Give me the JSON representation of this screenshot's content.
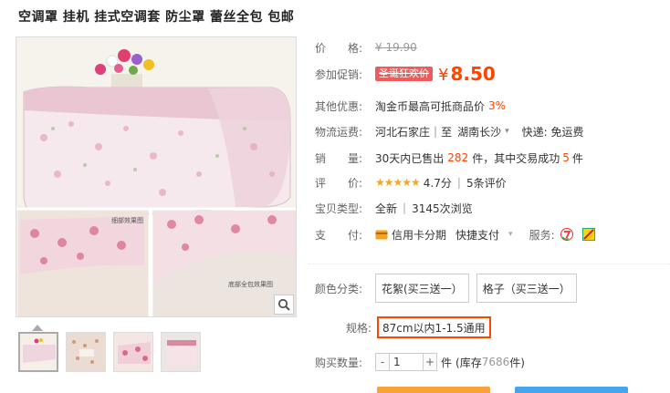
{
  "product": {
    "title": "空调罩 挂机 挂式空调套 防尘罩 蕾丝全包 包邮"
  },
  "gallery": {
    "watermark_1": "细部效果图",
    "watermark_2": "底部全包效果图",
    "thumbnails": [
      {
        "name": "thumb-1"
      },
      {
        "name": "thumb-2"
      },
      {
        "name": "thumb-3"
      },
      {
        "name": "thumb-4"
      }
    ]
  },
  "details": {
    "price_label": "价　　格:",
    "price_original": "¥ 19.90",
    "promo_label": "参加促销:",
    "promo_tag": "圣诞狂欢价",
    "promo_currency": "¥",
    "promo_price": "8.50",
    "other_label": "其他优惠:",
    "other_text": "淘金币最高可抵商品价",
    "other_pct": "3%",
    "shipping_label": "物流运费:",
    "ship_from": "河北石家庄",
    "ship_sep": "|",
    "ship_to_prefix": "至",
    "ship_to": "湖南长沙",
    "ship_fee": "快递: 免运费",
    "sales_label": "销　　量:",
    "sales_prefix": "30天内已售出",
    "sales_count": "282",
    "sales_mid": "件，其中交易成功",
    "sales_success": "5",
    "sales_suffix": "件",
    "rating_label": "评　　价:",
    "rating_stars": "★★★★★",
    "rating_score": "4.7分",
    "rating_sep": "|",
    "rating_reviews": "5条评价",
    "type_label": "宝贝类型:",
    "type_value": "全新",
    "type_sep": "|",
    "type_views": "3145次浏览",
    "pay_label": "支　　付:",
    "pay_credit": "信用卡分期",
    "pay_quick": "快捷支付",
    "service_label": "服务:"
  },
  "sku": {
    "color_label": "颜色分类:",
    "color_options": [
      "花絮(买三送一）",
      "格子（买三送一）"
    ],
    "size_label": "规格:",
    "size_option": "87cm以内1-1.5通用",
    "qty_label": "购买数量:",
    "qty_minus": "-",
    "qty_value": "1",
    "qty_plus": "+",
    "qty_unit": "件",
    "stock_prefix": "(库存",
    "stock_value": "7686",
    "stock_suffix": "件)"
  },
  "colors": {
    "accent": "#ff4400",
    "promo_tag_bg": "#f05a5a",
    "buy_now": "#f9a23a",
    "add_cart": "#45a6f0"
  }
}
